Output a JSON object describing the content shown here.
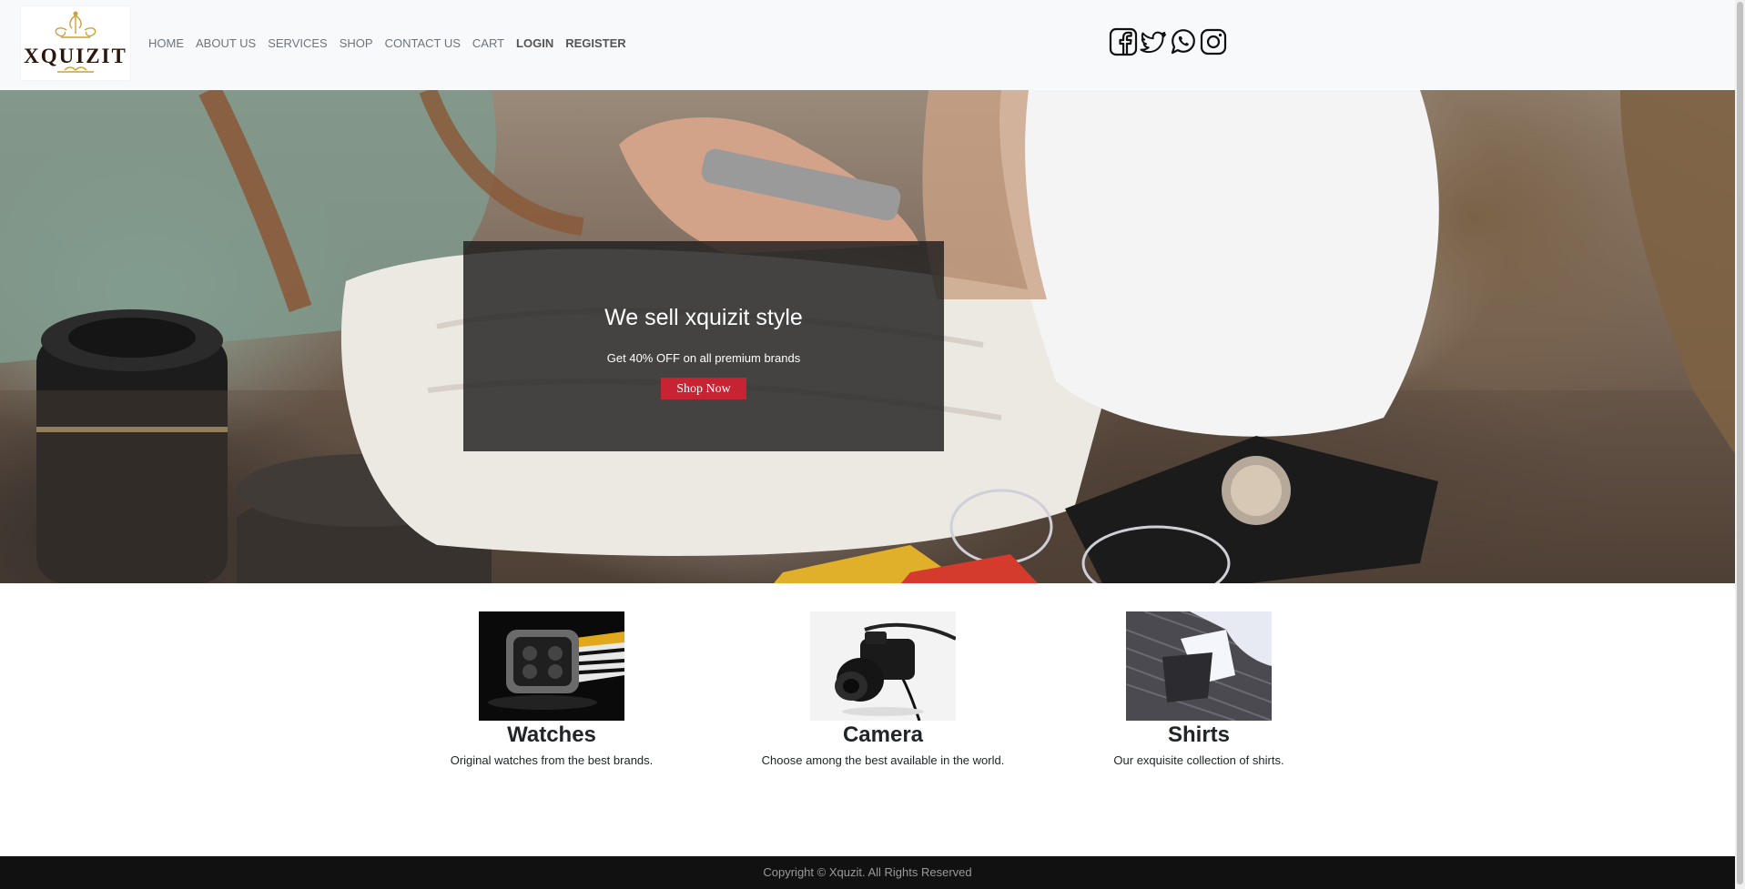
{
  "brand": {
    "name": "XQUIZIT"
  },
  "nav": {
    "items": [
      {
        "label": "HOME"
      },
      {
        "label": "ABOUT US"
      },
      {
        "label": "SERVICES"
      },
      {
        "label": "SHOP"
      },
      {
        "label": "CONTACT US"
      },
      {
        "label": "CART"
      },
      {
        "label": "LOGIN"
      },
      {
        "label": "REGISTER"
      }
    ]
  },
  "social": [
    "facebook-icon",
    "twitter-icon",
    "whatsapp-icon",
    "instagram-icon"
  ],
  "hero": {
    "title": "We sell xquizit style",
    "subtitle": "Get 40% OFF on all premium brands",
    "button": "Shop Now"
  },
  "features": [
    {
      "title": "Watches",
      "text": "Original watches from the best brands."
    },
    {
      "title": "Camera",
      "text": "Choose among the best available in the world."
    },
    {
      "title": "Shirts",
      "text": "Our exquisite collection of shirts."
    }
  ],
  "footer": {
    "text": "Copyright © Xquzit. All Rights Reserved"
  },
  "colors": {
    "accent": "#c82333",
    "navbar": "#f8f9fa",
    "footer": "#111111"
  }
}
